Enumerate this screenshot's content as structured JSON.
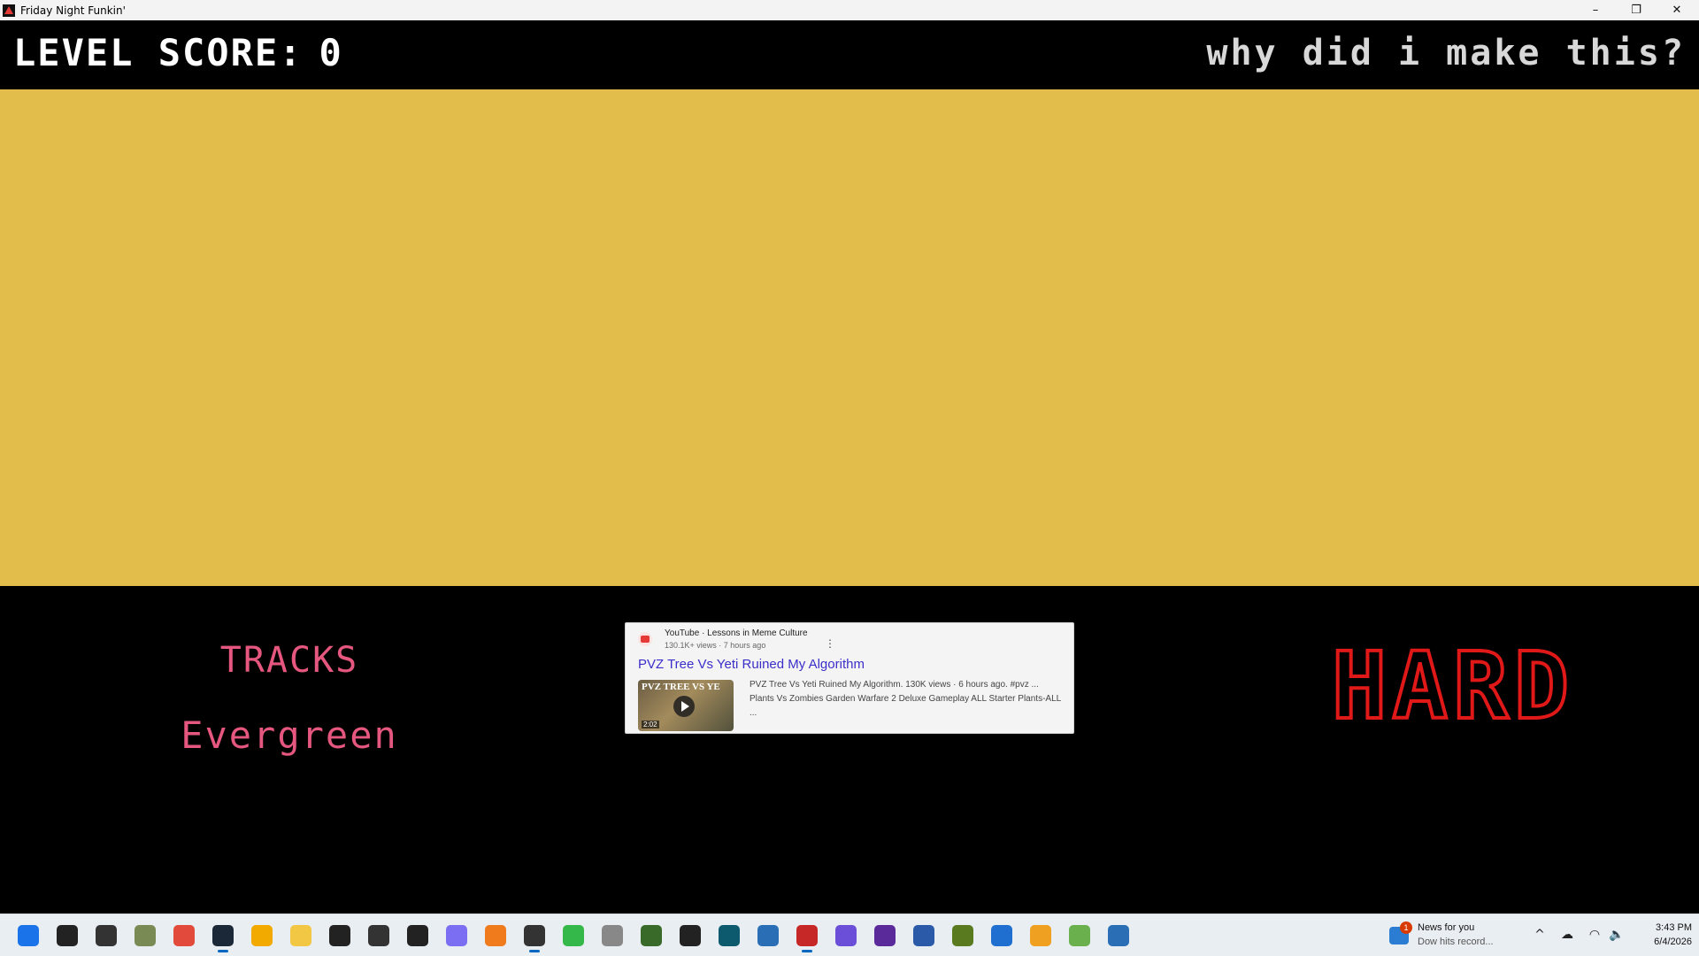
{
  "window": {
    "title": "Friday Night Funkin'",
    "controls": {
      "minimize": "–",
      "maximize": "❐",
      "close": "✕"
    }
  },
  "game": {
    "level_score_label": "LEVEL SCORE:",
    "level_score_value": "0",
    "week_title": "why did i make this?",
    "banner_color": "#e2bd4b",
    "tracks_label": "TRACKS",
    "tracks": [
      "Evergreen"
    ],
    "difficulty": "HARD",
    "difficulty_color": "#e01818",
    "track_text_color": "#e5577e"
  },
  "week_card": {
    "source": "YouTube · Lessons in Meme Culture",
    "meta": "130.1K+ views · 7 hours ago",
    "title": "PVZ Tree Vs Yeti Ruined My Algorithm",
    "thumb_text": "PVZ TREE VS YE",
    "duration": "2:02",
    "description": "PVZ Tree Vs Yeti Ruined My Algorithm. 130K views · 6 hours ago. #pvz ... Plants Vs Zombies Garden Warfare 2 Deluxe Gameplay ALL Starter Plants-ALL ..."
  },
  "taskbar": {
    "icons": [
      {
        "name": "start-icon",
        "color": "#1a73e8"
      },
      {
        "name": "search-icon",
        "color": "#222222"
      },
      {
        "name": "task-view-icon",
        "color": "#333333"
      },
      {
        "name": "pvz-app-icon",
        "color": "#7a8a55"
      },
      {
        "name": "chrome-icon",
        "color": "#e24a3b"
      },
      {
        "name": "steam-icon",
        "color": "#1b2838"
      },
      {
        "name": "chrome-canary-icon",
        "color": "#f2a900"
      },
      {
        "name": "file-explorer-icon",
        "color": "#f2c744"
      },
      {
        "name": "m-app-icon",
        "color": "#222222"
      },
      {
        "name": "settings-app-icon",
        "color": "#333333"
      },
      {
        "name": "pen-app-icon",
        "color": "#222222"
      },
      {
        "name": "controller-app-icon",
        "color": "#7b6ef2"
      },
      {
        "name": "fl-studio-icon",
        "color": "#f07b1c"
      },
      {
        "name": "obs-icon",
        "color": "#333333"
      },
      {
        "name": "paint-tool-icon",
        "color": "#35b84a"
      },
      {
        "name": "mouse-app-icon",
        "color": "#888888"
      },
      {
        "name": "star-app-icon",
        "color": "#3a6a2a"
      },
      {
        "name": "keyboard-app-icon",
        "color": "#222222"
      },
      {
        "name": "terminal-app-icon",
        "color": "#0d5a6e"
      },
      {
        "name": "globe-app-icon",
        "color": "#2a6fb5"
      },
      {
        "name": "fnf-app-icon",
        "color": "#c62828"
      },
      {
        "name": "crystal-app-icon",
        "color": "#6b4fd8"
      },
      {
        "name": "gem-app-icon",
        "color": "#5a2a9a"
      },
      {
        "name": "music-notes-app-icon",
        "color": "#2b5aa8"
      },
      {
        "name": "bug-app-icon",
        "color": "#5a7a20"
      },
      {
        "name": "monitor-app-icon",
        "color": "#1f6fd1"
      },
      {
        "name": "headphones-app-icon",
        "color": "#f0a020"
      },
      {
        "name": "leaf-app-icon",
        "color": "#6ab04c"
      },
      {
        "name": "web-app-icon",
        "color": "#2a6fb5"
      }
    ]
  },
  "news": {
    "badge": "1",
    "title": "News for you",
    "subtitle": "Dow hits record..."
  },
  "tray": {
    "chevron": "^",
    "cloud": "☁",
    "wifi": "◠",
    "volume": "🔈"
  },
  "clock": {
    "time": "3:43 PM",
    "date": "6/4/2026"
  }
}
